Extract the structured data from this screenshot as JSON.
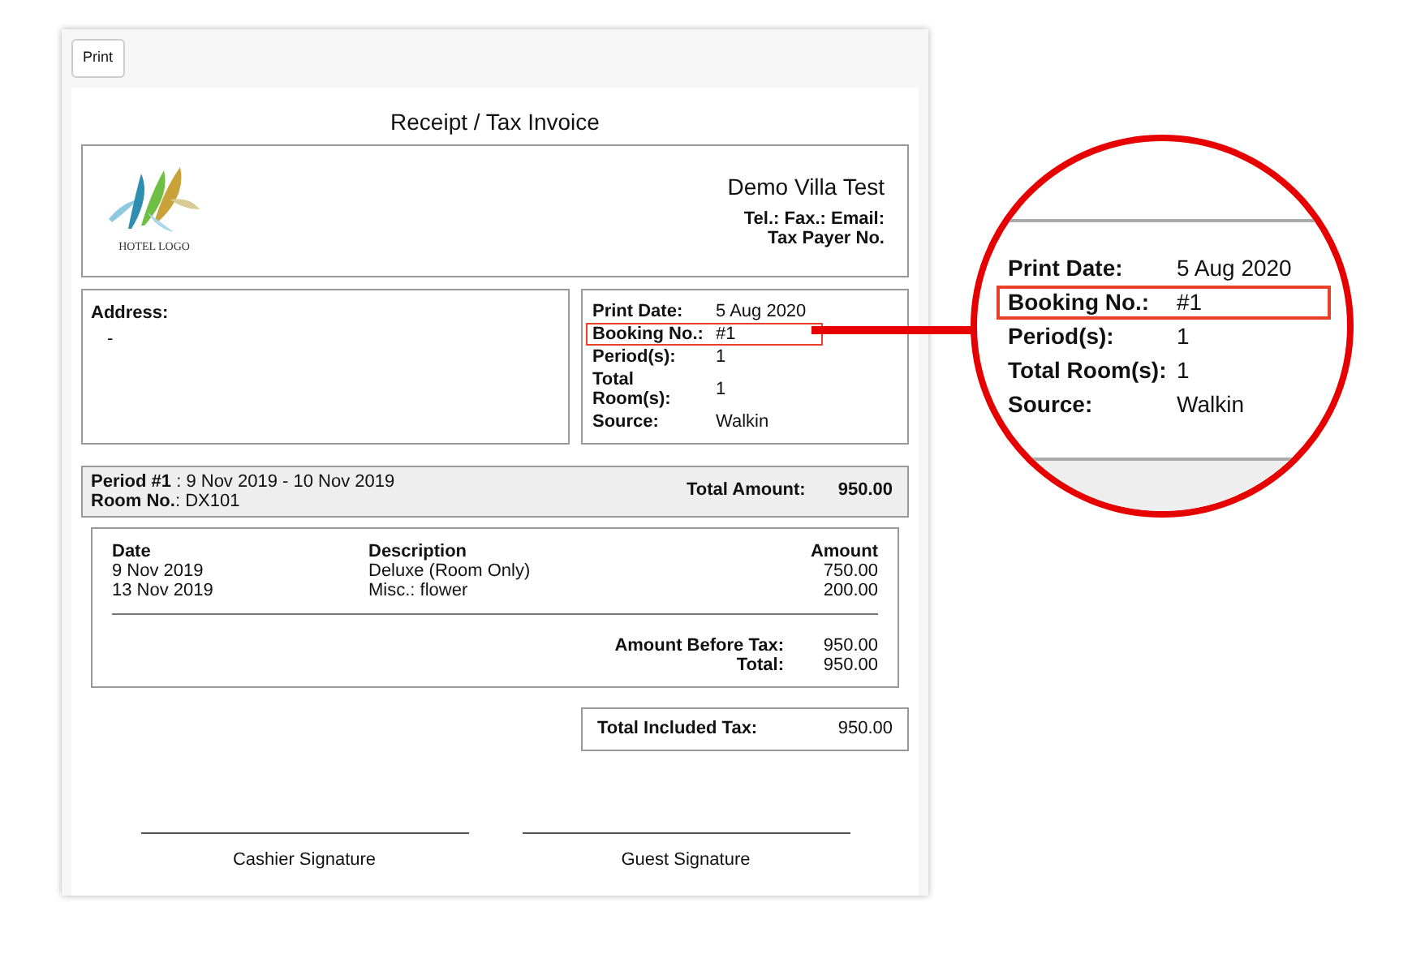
{
  "print_button": "Print",
  "invoice": {
    "title": "Receipt / Tax Invoice",
    "hotel": {
      "logo_text": "HOTEL LOGO",
      "name": "Demo Villa Test",
      "contact": "Tel.: Fax.: Email:",
      "tax_payer": "Tax Payer No."
    },
    "address": {
      "label": "Address:",
      "value": "-"
    },
    "info": [
      {
        "label": "Print Date:",
        "value": "5 Aug 2020",
        "highlighted": false
      },
      {
        "label": "Booking No.:",
        "value": "#1",
        "highlighted": true
      },
      {
        "label": "Period(s):",
        "value": "1",
        "highlighted": false
      },
      {
        "label": "Total Room(s):",
        "value": "1",
        "highlighted": false
      },
      {
        "label": "Source:",
        "value": "Walkin",
        "highlighted": false
      }
    ],
    "period": {
      "line": "**Period #1** : 9 Nov 2019 - 10 Nov 2019",
      "room": "**Room No.**: DX101",
      "total_label": "Total Amount:",
      "total": "950.00"
    },
    "items": {
      "columns": [
        "Date",
        "Description",
        "Amount"
      ],
      "rows": [
        [
          "9 Nov 2019",
          "Deluxe (Room Only)",
          "750.00"
        ],
        [
          "13 Nov 2019",
          "Misc.: flower",
          "200.00"
        ]
      ]
    },
    "summary": [
      {
        "label": "Amount Before Tax:",
        "value": "950.00"
      },
      {
        "label": "Total:",
        "value": "950.00"
      }
    ],
    "included_tax": {
      "label": "Total Included Tax:",
      "value": "950.00"
    },
    "signatures": [
      "Cashier Signature",
      "Guest Signature"
    ]
  },
  "callout": {
    "rows": [
      {
        "label": "Print Date:",
        "value": "5 Aug 2020",
        "highlighted": false
      },
      {
        "label": "Booking No.:",
        "value": "#1",
        "highlighted": true
      },
      {
        "label": "Period(s):",
        "value": "1",
        "highlighted": false
      },
      {
        "label": "Total Room(s):",
        "value": "1",
        "highlighted": false
      },
      {
        "label": "Source:",
        "value": "Walkin",
        "highlighted": false
      }
    ]
  }
}
